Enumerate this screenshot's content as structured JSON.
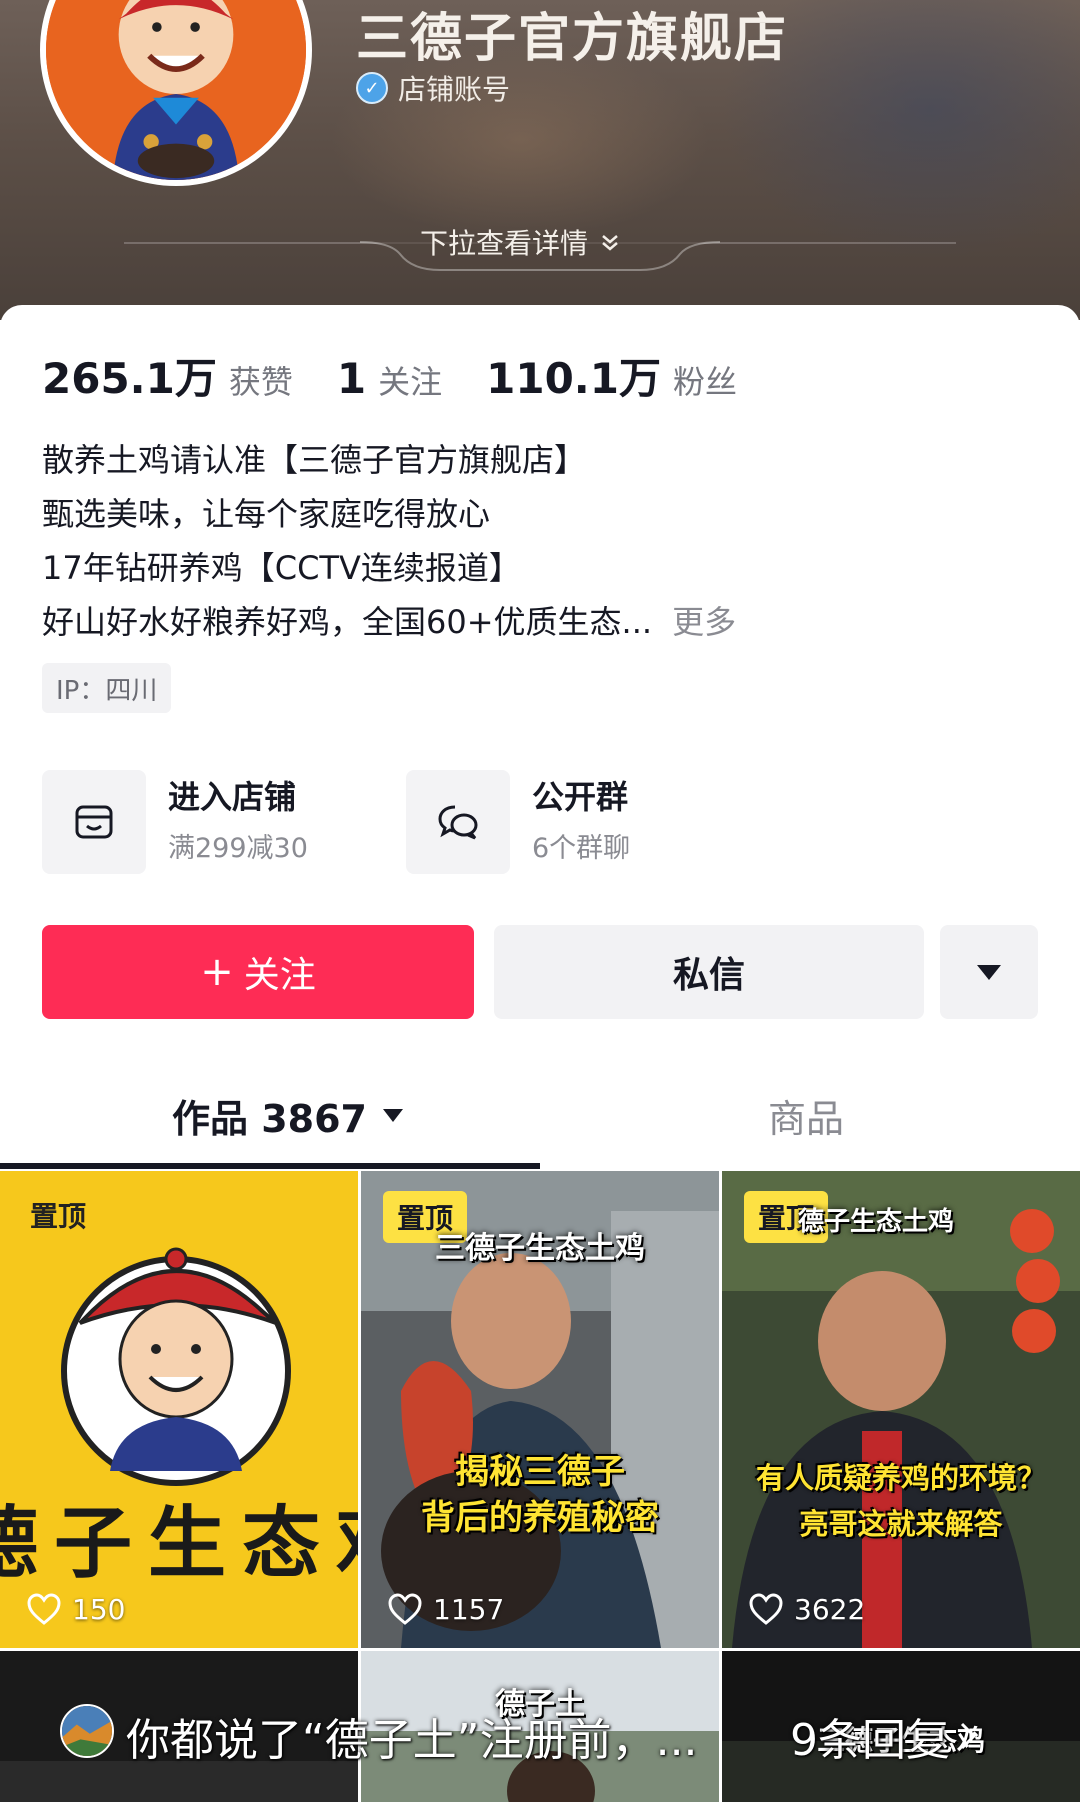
{
  "header": {
    "shop_name": "三德子官方旗舰店",
    "account_type": "店铺账号",
    "pull_down_label": "下拉查看详情"
  },
  "stats": [
    {
      "value": "265.1万",
      "label": "获赞"
    },
    {
      "value": "1",
      "label": "关注"
    },
    {
      "value": "110.1万",
      "label": "粉丝"
    }
  ],
  "bio": {
    "lines": [
      "散养土鸡请认准【三德子官方旗舰店】",
      "甄选美味，让每个家庭吃得放心",
      "17年钻研养鸡【CCTV连续报道】",
      "好山好水好粮养好鸡，全国60+优质生态..."
    ],
    "more": "更多"
  },
  "ip_tag": "IP：四川",
  "entries": {
    "shop": {
      "title": "进入店铺",
      "subtitle": "满299减30",
      "icon": "store-icon"
    },
    "group": {
      "title": "公开群",
      "subtitle": "6个群聊",
      "icon": "chat-bubbles-icon"
    }
  },
  "actions": {
    "follow": "关注",
    "message": "私信",
    "more_icon": "caret-down-icon"
  },
  "tabs": {
    "works": "作品 3867",
    "products": "商品"
  },
  "videos": [
    {
      "pin": "置顶",
      "slogan": "德子生态鸡",
      "likes": "150"
    },
    {
      "pin": "置顶",
      "title": "三德子生态土鸡",
      "caption_1": "揭秘三德子",
      "caption_2": "背后的养殖秘密",
      "likes": "1157"
    },
    {
      "pin": "置顶",
      "title": "德子生态土鸡",
      "caption_1": "有人质疑养鸡的环境？",
      "caption_2": "亮哥这就来解答",
      "likes": "3622"
    },
    {
      "title": "德子土"
    },
    {
      "title": "三德子生态鸡"
    }
  ],
  "comment": {
    "text": "你都说了“德子土”注册前，...",
    "replies": "9条回复"
  },
  "colors": {
    "accent": "#fe2c55",
    "pin_badge": "#fde143",
    "verify": "#4da3e8"
  }
}
